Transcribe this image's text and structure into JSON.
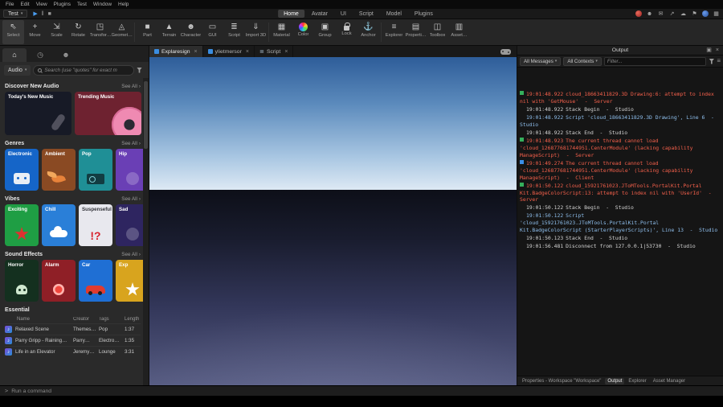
{
  "glyphs": {
    "caret": "▾",
    "chevron": "›",
    "close": "×",
    "dock": "▣",
    "menu": "≡"
  },
  "menubar": {
    "items": [
      "File",
      "Edit",
      "View",
      "Plugins",
      "Test",
      "Window",
      "Help"
    ]
  },
  "topbar": {
    "mode_label": "Test",
    "controls": [
      {
        "glyph": "▶",
        "cls": "play",
        "name": "play-button"
      },
      {
        "glyph": "‖",
        "cls": "",
        "name": "pause-button"
      },
      {
        "glyph": "■",
        "cls": "",
        "name": "stop-button"
      }
    ],
    "tabs": [
      {
        "label": "Home",
        "cls": "active"
      },
      {
        "label": "Avatar",
        "cls": ""
      },
      {
        "label": "UI",
        "cls": ""
      },
      {
        "label": "Script",
        "cls": ""
      },
      {
        "label": "Model",
        "cls": ""
      },
      {
        "label": "Plugins",
        "cls": ""
      }
    ],
    "right_icons": [
      {
        "glyph": "",
        "cls": "avatar avatar-red",
        "name": "user-avatar-red"
      },
      {
        "glyph": "☻",
        "cls": "",
        "name": "collaborate-icon"
      },
      {
        "glyph": "✉",
        "cls": "",
        "name": "chat-icon"
      },
      {
        "glyph": "↗",
        "cls": "",
        "name": "share-icon"
      },
      {
        "glyph": "☁",
        "cls": "",
        "name": "cloud-sync-icon"
      },
      {
        "glyph": "⚑",
        "cls": "",
        "name": "notifications-icon"
      },
      {
        "glyph": "",
        "cls": "avatar avatar-blue",
        "name": "user-avatar-blue"
      },
      {
        "glyph": "▦",
        "cls": "",
        "name": "apps-grid-icon"
      }
    ]
  },
  "ribbon": {
    "buttons": [
      {
        "label": "Select",
        "glyph": "⇖",
        "cls": "active",
        "name": "select-tool-button"
      },
      {
        "label": "Move",
        "glyph": "+",
        "cls": "",
        "name": "move-tool-button"
      },
      {
        "label": "Scale",
        "glyph": "⇲",
        "cls": "",
        "name": "scale-tool-button"
      },
      {
        "label": "Rotate",
        "glyph": "↻",
        "cls": "",
        "name": "rotate-tool-button"
      },
      {
        "label": "Transfor…",
        "glyph": "◳",
        "cls": "",
        "name": "transform-tool-button"
      },
      {
        "label": "Geomet…",
        "glyph": "◬",
        "cls": "",
        "name": "geometric-tool-button"
      },
      {
        "cls": "divider",
        "name": "ribbon-divider"
      },
      {
        "label": "Part",
        "glyph": "■",
        "cls": "",
        "name": "part-button"
      },
      {
        "label": "Terrain",
        "glyph": "▲",
        "cls": "",
        "name": "terrain-button"
      },
      {
        "label": "Character",
        "glyph": "☻",
        "cls": "",
        "name": "character-button"
      },
      {
        "label": "GUI",
        "glyph": "▭",
        "cls": "",
        "name": "gui-button"
      },
      {
        "label": "Script",
        "glyph": "≣",
        "cls": "",
        "name": "script-button"
      },
      {
        "label": "Import 3D",
        "glyph": "⇓",
        "cls": "",
        "name": "import-3d-button"
      },
      {
        "cls": "divider",
        "name": "ribbon-divider"
      },
      {
        "label": "Material",
        "glyph": "▦",
        "cls": "",
        "name": "material-button"
      },
      {
        "label": "Color",
        "glyph": "",
        "cls": "colorwheel",
        "name": "color-button"
      },
      {
        "label": "Group",
        "glyph": "▣",
        "cls": "",
        "name": "group-button"
      },
      {
        "label": "Lock",
        "glyph": "",
        "cls": "lockicon",
        "name": "lock-button"
      },
      {
        "label": "Anchor",
        "glyph": "⚓",
        "cls": "",
        "name": "anchor-button"
      },
      {
        "cls": "divider",
        "name": "ribbon-divider"
      },
      {
        "label": "Explorer",
        "glyph": "≡",
        "cls": "",
        "name": "explorer-button"
      },
      {
        "label": "Properti…",
        "glyph": "▤",
        "cls": "",
        "name": "properties-button"
      },
      {
        "label": "Toolbox",
        "glyph": "◫",
        "cls": "",
        "name": "toolbox-button"
      },
      {
        "label": "Asset…",
        "glyph": "▥",
        "cls": "",
        "name": "asset-manager-button"
      }
    ]
  },
  "toolbox": {
    "panel_tabs": [
      {
        "glyph": "⌂",
        "cls": "active",
        "name": "marketplace-tab"
      },
      {
        "glyph": "◷",
        "cls": "",
        "name": "recent-tab"
      },
      {
        "glyph": "☻",
        "cls": "",
        "name": "creations-tab"
      }
    ],
    "category": "Audio",
    "search_placeholder": "Search (use \"quotes\" for exact m",
    "discover": {
      "title": "Discover New Audio",
      "see_all": "See All",
      "cards": [
        {
          "label": "Today's New Music",
          "bg": "#171a26",
          "art": "art-mic",
          "art_text": ""
        },
        {
          "label": "Trending Music",
          "bg": "#6e2230",
          "art": "art-vinyl",
          "art_text": ""
        }
      ]
    },
    "genres": {
      "title": "Genres",
      "see_all": "See All",
      "cards": [
        {
          "label": "Electronic",
          "bg": "#1565c8",
          "art": "art-robot",
          "art_text": ""
        },
        {
          "label": "Ambient",
          "bg": "#8a4a23",
          "art": "art-leaves",
          "art_text": ""
        },
        {
          "label": "Pop",
          "bg": "#1f8f96",
          "art": "art-radio",
          "art_text": ""
        },
        {
          "label": "Hip",
          "bg": "#6a3fb5",
          "art": "art-circle",
          "art_text": ""
        }
      ]
    },
    "vibes": {
      "title": "Vibes",
      "see_all": "See All",
      "cards": [
        {
          "label": "Exciting",
          "bg": "#1f9e44",
          "art": "art-firework",
          "art_text": ""
        },
        {
          "label": "Chill",
          "bg": "#2a7fd8",
          "art": "art-cloud",
          "art_text": ""
        },
        {
          "label": "Suspenseful",
          "bg": "#e8e8ee",
          "fg": "#33343a",
          "art": "art-text",
          "art_text": "!?"
        },
        {
          "label": "Sad",
          "bg": "#2e2560",
          "art": "art-circle",
          "art_text": ""
        }
      ]
    },
    "sfx": {
      "title": "Sound Effects",
      "see_all": "See All",
      "cards": [
        {
          "label": "Horror",
          "bg": "#14301f",
          "art": "art-skull",
          "art_text": ""
        },
        {
          "label": "Alarm",
          "bg": "#8f1f26",
          "art": "art-alarm",
          "art_text": ""
        },
        {
          "label": "Car",
          "bg": "#1f6fd4",
          "art": "art-car",
          "art_text": ""
        },
        {
          "label": "Exp",
          "bg": "#d8a41e",
          "art": "art-burst",
          "art_text": ""
        }
      ]
    },
    "essential": {
      "title": "Essential",
      "note_glyph": "♪",
      "headers": [
        "Name",
        "Creator",
        "Tags",
        "Length"
      ],
      "rows": [
        {
          "name": "Relaxed Scene",
          "creator": "Themes…",
          "tags": "Pop",
          "length": "1:37"
        },
        {
          "name": "Parry Gripp - Raining…",
          "creator": "Parry…",
          "tags": "Electro…",
          "length": "1:35"
        },
        {
          "name": "Life in an Elevator",
          "creator": "Jeremy…",
          "tags": "Lounge",
          "length": "3:31"
        }
      ]
    }
  },
  "viewport": {
    "close_glyph": "×",
    "tabs": [
      {
        "label": "Explaresign",
        "cls": "active",
        "icon": "cube",
        "icon_glyph": ""
      },
      {
        "label": "ylietmersor",
        "cls": "",
        "icon": "cube",
        "icon_glyph": ""
      },
      {
        "label": "Script",
        "cls": "",
        "icon": "scriptdoc",
        "icon_glyph": "≣"
      }
    ]
  },
  "output": {
    "title": "Output",
    "filters": {
      "messages": "All Messages",
      "contexts": "All Contexts",
      "placeholder": "Filter..."
    },
    "log": [
      {
        "marker": "m-server",
        "time": "19:01:48.922",
        "text": "cloud_18663411829.3D Drawing:6: attempt to index nil with 'GetMouse'  -  Server",
        "cls": "error"
      },
      {
        "marker": "m-hidden",
        "time": "19:01:48.922",
        "text": "Stack Begin  -  Studio",
        "cls": "info"
      },
      {
        "marker": "m-hidden",
        "time": "19:01:48.922",
        "text": "Script 'cloud_18663411829.3D Drawing', Line 6  -  Studio",
        "cls": "script"
      },
      {
        "marker": "m-hidden",
        "time": "19:01:48.922",
        "text": "Stack End  -  Studio",
        "cls": "info"
      },
      {
        "marker": "m-server",
        "time": "19:01:48.923",
        "text": "The current thread cannot load 'cloud_126877681744951.CenterModule' (lacking capability ManageScript)  -  Server",
        "cls": "error"
      },
      {
        "marker": "m-client",
        "time": "19:01:49.274",
        "text": "The current thread cannot load 'cloud_126877681744951.CenterModule' (lacking capability ManageScript)  -  Client",
        "cls": "error"
      },
      {
        "marker": "m-server",
        "time": "19:01:50.122",
        "text": "cloud_15921761023.JToMTools.PortalKit.Portal Kit.BadgeColorScript:13: attempt to index nil with 'UserId'  -  Server",
        "cls": "error"
      },
      {
        "marker": "m-hidden",
        "time": "19:01:50.122",
        "text": "Stack Begin  -  Studio",
        "cls": "info"
      },
      {
        "marker": "m-hidden",
        "time": "19:01:50.122",
        "text": "Script 'cloud_15921761023.JToMTools.PortalKit.Portal Kit.BadgeColorScript (StarterPlayerScripts)', Line 13  -  Studio",
        "cls": "script"
      },
      {
        "marker": "m-hidden",
        "time": "19:01:50.123",
        "text": "Stack End  -  Studio",
        "cls": "info"
      },
      {
        "marker": "m-hidden",
        "time": "19:01:56.481",
        "text": "Disconnect from 127.0.0.1|53730  -  Studio",
        "cls": "info"
      }
    ],
    "bottom_tabs": [
      {
        "label": "Properties - Workspace \"Workspace\"",
        "cls": ""
      },
      {
        "label": "Output",
        "cls": "active"
      },
      {
        "label": "Explorer",
        "cls": ""
      },
      {
        "label": "Asset Manager",
        "cls": ""
      }
    ]
  },
  "statusbar": {
    "prompt_glyph": ">",
    "command_text": "Run a command"
  }
}
